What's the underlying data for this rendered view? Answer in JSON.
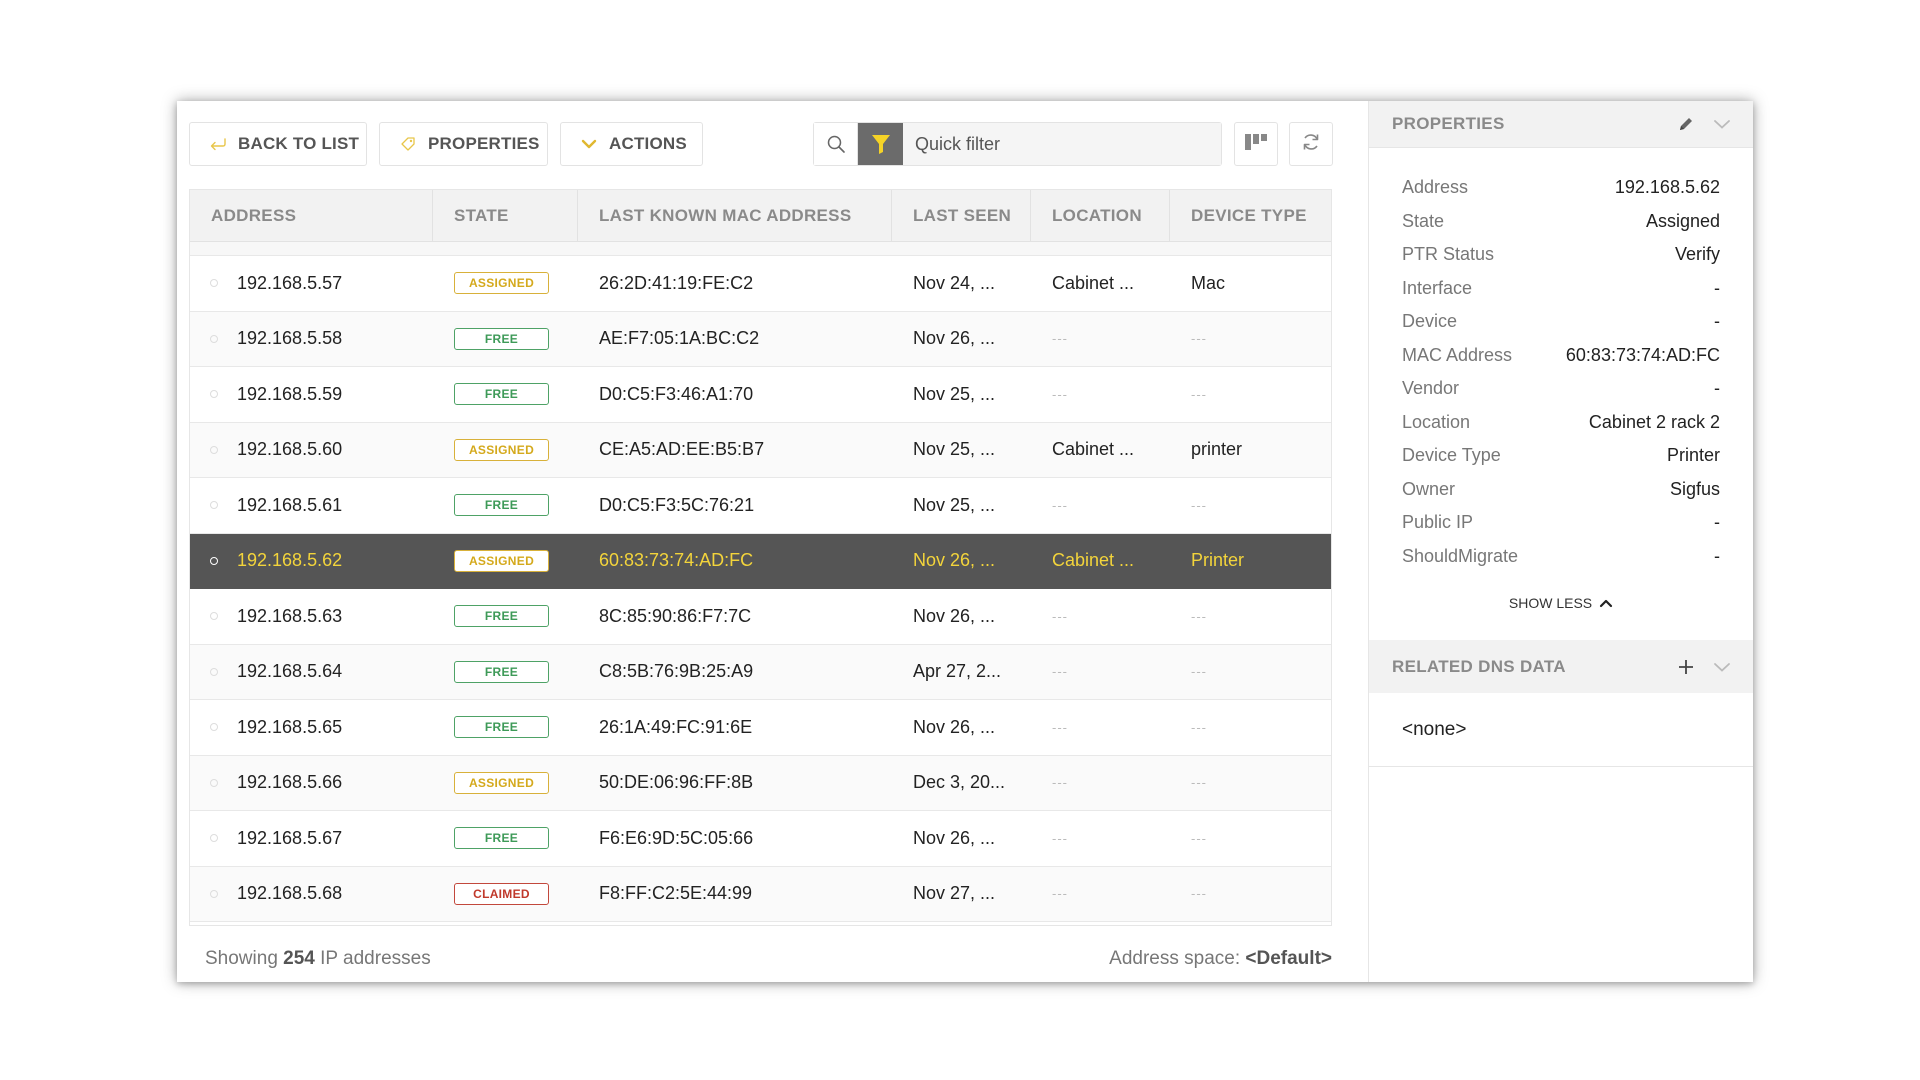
{
  "toolbar": {
    "back_label": "BACK TO LIST",
    "properties_label": "PROPERTIES",
    "actions_label": "ACTIONS",
    "quick_filter_placeholder": "Quick filter",
    "quick_filter_value": ""
  },
  "colors": {
    "accent": "#f3d43b",
    "selected_row_bg": "#555555",
    "assigned": "#d4a91c",
    "free": "#3e9a58",
    "claimed": "#c0392b"
  },
  "table": {
    "columns": [
      "ADDRESS",
      "STATE",
      "LAST KNOWN MAC ADDRESS",
      "LAST SEEN",
      "LOCATION",
      "DEVICE TYPE"
    ],
    "rows": [
      {
        "address": "192.168.5.57",
        "state": "ASSIGNED",
        "mac": "26:2D:41:19:FE:C2",
        "last_seen": "Nov 24, ...",
        "location": "Cabinet ...",
        "device_type": "Mac"
      },
      {
        "address": "192.168.5.58",
        "state": "FREE",
        "mac": "AE:F7:05:1A:BC:C2",
        "last_seen": "Nov 26, ...",
        "location": "---",
        "device_type": "---"
      },
      {
        "address": "192.168.5.59",
        "state": "FREE",
        "mac": "D0:C5:F3:46:A1:70",
        "last_seen": "Nov 25, ...",
        "location": "---",
        "device_type": "---"
      },
      {
        "address": "192.168.5.60",
        "state": "ASSIGNED",
        "mac": "CE:A5:AD:EE:B5:B7",
        "last_seen": "Nov 25, ...",
        "location": "Cabinet ...",
        "device_type": "printer"
      },
      {
        "address": "192.168.5.61",
        "state": "FREE",
        "mac": "D0:C5:F3:5C:76:21",
        "last_seen": "Nov 25, ...",
        "location": "---",
        "device_type": "---"
      },
      {
        "address": "192.168.5.62",
        "state": "ASSIGNED",
        "mac": "60:83:73:74:AD:FC",
        "last_seen": "Nov 26, ...",
        "location": "Cabinet ...",
        "device_type": "Printer",
        "selected": true
      },
      {
        "address": "192.168.5.63",
        "state": "FREE",
        "mac": "8C:85:90:86:F7:7C",
        "last_seen": "Nov 26, ...",
        "location": "---",
        "device_type": "---"
      },
      {
        "address": "192.168.5.64",
        "state": "FREE",
        "mac": "C8:5B:76:9B:25:A9",
        "last_seen": "Apr 27, 2...",
        "location": "---",
        "device_type": "---"
      },
      {
        "address": "192.168.5.65",
        "state": "FREE",
        "mac": "26:1A:49:FC:91:6E",
        "last_seen": "Nov 26, ...",
        "location": "---",
        "device_type": "---"
      },
      {
        "address": "192.168.5.66",
        "state": "ASSIGNED",
        "mac": "50:DE:06:96:FF:8B",
        "last_seen": "Dec 3, 20...",
        "location": "---",
        "device_type": "---"
      },
      {
        "address": "192.168.5.67",
        "state": "FREE",
        "mac": "F6:E6:9D:5C:05:66",
        "last_seen": "Nov 26, ...",
        "location": "---",
        "device_type": "---"
      },
      {
        "address": "192.168.5.68",
        "state": "CLAIMED",
        "mac": "F8:FF:C2:5E:44:99",
        "last_seen": "Nov 27, ...",
        "location": "---",
        "device_type": "---"
      }
    ]
  },
  "footer": {
    "showing_prefix": "Showing",
    "count": "254",
    "showing_suffix": "IP addresses",
    "address_space_label": "Address space:",
    "address_space_value": "<Default>"
  },
  "properties_panel": {
    "title": "PROPERTIES",
    "items": [
      {
        "key": "Address",
        "value": "192.168.5.62"
      },
      {
        "key": "State",
        "value": "Assigned"
      },
      {
        "key": "PTR Status",
        "value": "Verify"
      },
      {
        "key": "Interface",
        "value": "-"
      },
      {
        "key": "Device",
        "value": "-"
      },
      {
        "key": "MAC Address",
        "value": "60:83:73:74:AD:FC"
      },
      {
        "key": "Vendor",
        "value": "-"
      },
      {
        "key": "Location",
        "value": "Cabinet 2 rack 2"
      },
      {
        "key": "Device Type",
        "value": "Printer"
      },
      {
        "key": "Owner",
        "value": "Sigfus"
      },
      {
        "key": "Public IP",
        "value": "-"
      },
      {
        "key": "ShouldMigrate",
        "value": "-"
      }
    ],
    "show_less_label": "SHOW LESS"
  },
  "dns_panel": {
    "title": "RELATED DNS DATA",
    "empty_text": "<none>"
  }
}
